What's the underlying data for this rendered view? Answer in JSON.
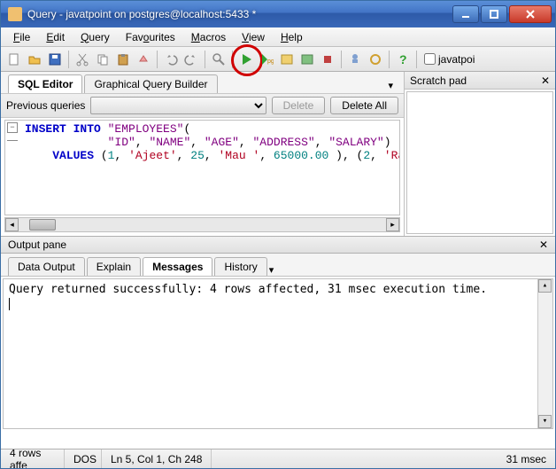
{
  "window": {
    "title": "Query - javatpoint on postgres@localhost:5433 *"
  },
  "menu": {
    "file": "File",
    "edit": "Edit",
    "query": "Query",
    "favourites": "Favourites",
    "macros": "Macros",
    "view": "View",
    "help": "Help"
  },
  "toolbar": {
    "checkbox_label": "javatpoi"
  },
  "editor_tabs": {
    "sql": "SQL Editor",
    "gqb": "Graphical Query Builder"
  },
  "prev": {
    "label": "Previous queries",
    "delete": "Delete",
    "delete_all": "Delete All"
  },
  "sql": {
    "l1a": "INSERT",
    "l1b": " INTO",
    "l1c": " \"EMPLOYEES\"",
    "l1d": "(",
    "l2a": "\"ID\"",
    "l2b": ", ",
    "l2c": "\"NAME\"",
    "l2d": ", ",
    "l2e": "\"AGE\"",
    "l2f": ", ",
    "l2g": "\"ADDRESS\"",
    "l2h": ", ",
    "l2i": "\"SALARY\"",
    "l2j": ")",
    "l3a": "VALUES",
    "l3b": " (",
    "l3c": "1",
    "l3d": ", ",
    "l3e": "'Ajeet'",
    "l3f": ", ",
    "l3g": "25",
    "l3h": ", ",
    "l3i": "'Mau '",
    "l3j": ", ",
    "l3k": "65000.00",
    "l3l": " ), (",
    "l3m": "2",
    "l3n": ", ",
    "l3o": "'Rak"
  },
  "scratch": {
    "title": "Scratch pad"
  },
  "output": {
    "pane_title": "Output pane",
    "tab_data": "Data Output",
    "tab_explain": "Explain",
    "tab_messages": "Messages",
    "tab_history": "History",
    "message": "Query returned successfully: 4 rows affected, 31 msec execution time."
  },
  "status": {
    "rows": "4 rows affe",
    "mode": "DOS",
    "pos": "Ln 5, Col 1, Ch 248",
    "time": "31 msec"
  }
}
